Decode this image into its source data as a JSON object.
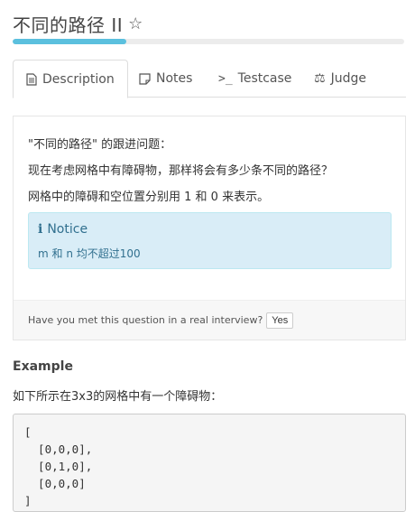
{
  "header": {
    "title": "不同的路径 II",
    "star_icon": "star-outline-icon",
    "progress_fraction": 0.29,
    "progress_color": "#5bc0de"
  },
  "tabs": [
    {
      "label": "Description",
      "icon": "document-icon",
      "active": true
    },
    {
      "label": "Notes",
      "icon": "note-icon",
      "active": false
    },
    {
      "label": "Testcase",
      "icon": "terminal-icon",
      "active": false
    },
    {
      "label": "Judge",
      "icon": "scales-icon",
      "active": false
    }
  ],
  "description": {
    "line1": "\"不同的路径\" 的跟进问题：",
    "line2": "现在考虑网格中有障碍物，那样将会有多少条不同的路径？",
    "line3": "网格中的障碍和空位置分别用 1 和 0 来表示。"
  },
  "notice": {
    "title": "Notice",
    "icon": "info-icon",
    "text": "m 和 n 均不超过100"
  },
  "interview": {
    "question": "Have you met this question in a real interview?",
    "yes_label": "Yes"
  },
  "example": {
    "heading": "Example",
    "desc": "如下所示在3x3的网格中有一个障碍物：",
    "code": "[\n  [0,0,0],\n  [0,1,0],\n  [0,0,0]\n]"
  }
}
